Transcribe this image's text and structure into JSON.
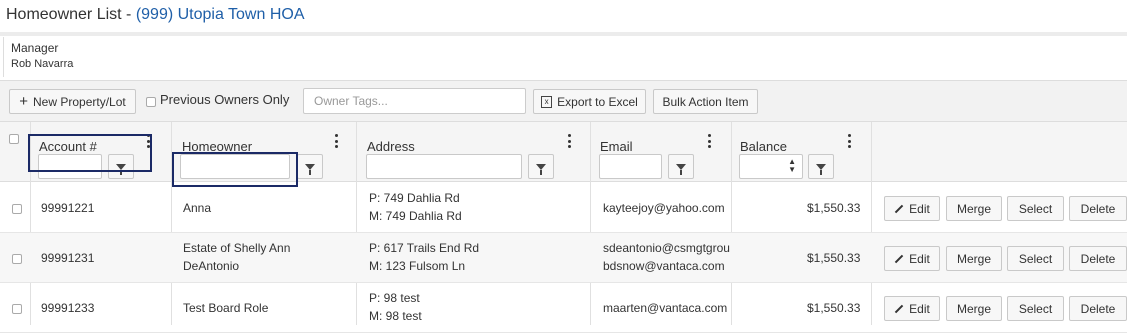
{
  "header": {
    "title_prefix": "Homeowner List - ",
    "hoa_name": "(999) Utopia Town HOA"
  },
  "manager": {
    "label": "Manager",
    "name": "Rob Navarra"
  },
  "toolbar": {
    "new_property": "New Property/Lot",
    "previous_owners": "Previous Owners Only",
    "owner_tags_placeholder": "Owner Tags...",
    "export": "Export to Excel",
    "bulk_action": "Bulk Action Item"
  },
  "columns": {
    "account": "Account #",
    "homeowner": "Homeowner",
    "address": "Address",
    "email": "Email",
    "balance": "Balance"
  },
  "actions": {
    "edit": "Edit",
    "merge": "Merge",
    "select": "Select",
    "delete": "Delete"
  },
  "rows": [
    {
      "account": "99991221",
      "homeowner_1": "Anna",
      "homeowner_2": "",
      "address_p": "P: 749 Dahlia Rd",
      "address_m": "M: 749 Dahlia Rd",
      "email_1": "kayteejoy@yahoo.com",
      "email_2": "",
      "balance": "$1,550.33"
    },
    {
      "account": "99991231",
      "homeowner_1": "Estate of Shelly Ann",
      "homeowner_2": "DeAntonio",
      "address_p": "P: 617 Trails End Rd",
      "address_m": "M: 123 Fulsom Ln",
      "email_1": "sdeantonio@csmgtgrou",
      "email_2": "bdsnow@vantaca.com",
      "balance": "$1,550.33"
    },
    {
      "account": "99991233",
      "homeowner_1": "Test Board Role",
      "homeowner_2": "",
      "address_p": "P: 98 test",
      "address_m": "M: 98 test",
      "email_1": "maarten@vantaca.com",
      "email_2": "",
      "balance": "$1,550.33"
    }
  ]
}
